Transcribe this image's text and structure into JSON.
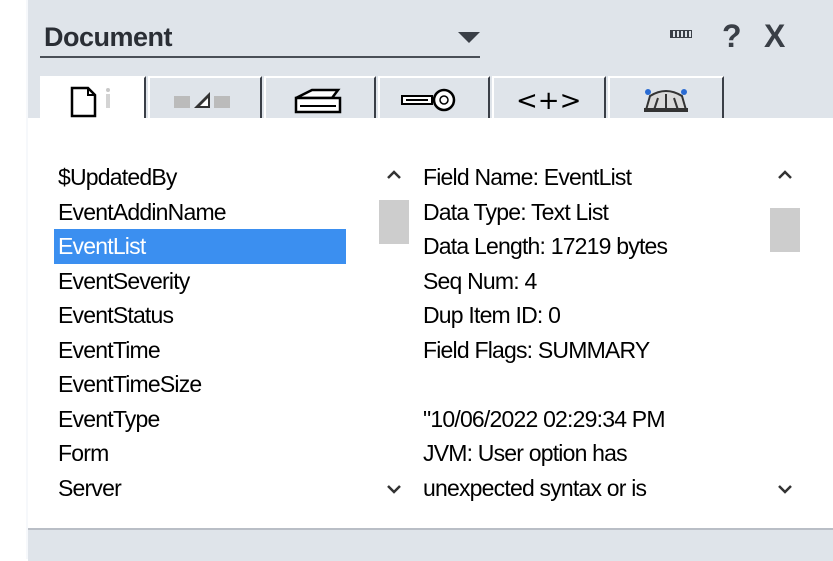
{
  "panel": {
    "title": "Document",
    "header_buttons": {
      "minimize_icon": "dock-bar-icon",
      "help": "?",
      "close": "X"
    }
  },
  "tabs": [
    {
      "name": "tab-basics",
      "icon": "document-info-icon"
    },
    {
      "name": "tab-field-properties",
      "icon": "triangle-ruler-icon"
    },
    {
      "name": "tab-printing",
      "icon": "printer-icon"
    },
    {
      "name": "tab-security",
      "icon": "key-icon"
    },
    {
      "name": "tab-html",
      "icon": "angle-brackets-icon",
      "label": "<+>"
    },
    {
      "name": "tab-advanced",
      "icon": "beanie-hat-icon"
    }
  ],
  "fields": {
    "items": [
      "$UpdatedBy",
      "EventAddinName",
      "EventList",
      "EventSeverity",
      "EventStatus",
      "EventTime",
      "EventTimeSize",
      "EventType",
      "Form",
      "Server"
    ],
    "selected_index": 2
  },
  "field_info": {
    "lines": [
      "Field Name: EventList",
      "Data Type: Text List",
      "Data Length: 17219 bytes",
      "Seq Num: 4",
      "Dup Item ID: 0",
      "Field Flags: SUMMARY",
      "",
      "\"10/06/2022 02:29:34 PM",
      " JVM: User option has",
      "unexpected syntax or is"
    ]
  },
  "colors": {
    "selection": "#3b8ff0",
    "panel_bg": "#dfe4ea"
  }
}
